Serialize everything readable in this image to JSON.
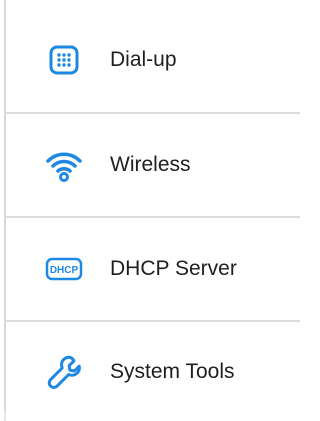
{
  "menu": {
    "items": [
      {
        "label": "Dial-up",
        "icon": "dialup-icon"
      },
      {
        "label": "Wireless",
        "icon": "wifi-icon"
      },
      {
        "label": "DHCP Server",
        "icon": "dhcp-icon",
        "icon_text": "DHCP"
      },
      {
        "label": "System Tools",
        "icon": "wrench-icon"
      }
    ],
    "accent_color": "#1e88e5",
    "divider_color": "#dcdcdc"
  }
}
